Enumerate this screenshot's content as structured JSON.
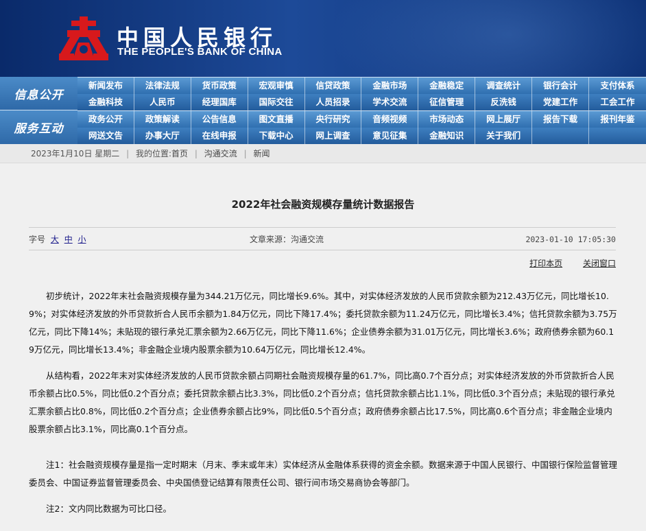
{
  "header": {
    "name_cn": "中国人民银行",
    "name_en": "THE PEOPLE'S BANK OF CHINA",
    "brand_color": "#d7191c"
  },
  "nav": {
    "groups": [
      {
        "tag": "信息公开",
        "rows": [
          [
            "新闻发布",
            "法律法规",
            "货币政策",
            "宏观审慎",
            "信贷政策",
            "金融市场",
            "金融稳定",
            "调查统计",
            "银行会计",
            "支付体系"
          ],
          [
            "金融科技",
            "人民币",
            "经理国库",
            "国际交往",
            "人员招录",
            "学术交流",
            "征信管理",
            "反洗钱",
            "党建工作",
            "工会工作"
          ]
        ]
      },
      {
        "tag": "服务互动",
        "rows": [
          [
            "政务公开",
            "政策解读",
            "公告信息",
            "图文直播",
            "央行研究",
            "音频视频",
            "市场动态",
            "网上展厅",
            "报告下载",
            "报刊年鉴"
          ],
          [
            "网送文告",
            "办事大厅",
            "在线申报",
            "下载中心",
            "网上调查",
            "意见征集",
            "金融知识",
            "关于我们",
            "",
            ""
          ]
        ]
      }
    ]
  },
  "breadcrumb": {
    "date": "2023年1月10日 星期二",
    "location_label": "我的位置:",
    "home": "首页",
    "section": "沟通交流",
    "page": "新闻"
  },
  "article": {
    "title": "2022年社会融资规模存量统计数据报告",
    "font_label": "字号",
    "font_large": "大",
    "font_medium": "中",
    "font_small": "小",
    "source": "文章来源：沟通交流",
    "datetime": "2023-01-10 17:05:30",
    "print_label": "打印本页",
    "close_label": "关闭窗口",
    "paragraphs": [
      "初步统计，2022年末社会融资规模存量为344.21万亿元，同比增长9.6%。其中，对实体经济发放的人民币贷款余额为212.43万亿元，同比增长10.9%；对实体经济发放的外币贷款折合人民币余额为1.84万亿元，同比下降17.4%；委托贷款余额为11.24万亿元，同比增长3.4%；信托贷款余额为3.75万亿元，同比下降14%；未贴现的银行承兑汇票余额为2.66万亿元，同比下降11.6%；企业债券余额为31.01万亿元，同比增长3.6%；政府债券余额为60.19万亿元，同比增长13.4%；非金融企业境内股票余额为10.64万亿元，同比增长12.4%。",
      "从结构看，2022年末对实体经济发放的人民币贷款余额占同期社会融资规模存量的61.7%，同比高0.7个百分点；对实体经济发放的外币贷款折合人民币余额占比0.5%，同比低0.2个百分点；委托贷款余额占比3.3%，同比低0.2个百分点；信托贷款余额占比1.1%，同比低0.3个百分点；未贴现的银行承兑汇票余额占比0.8%，同比低0.2个百分点；企业债券余额占比9%，同比低0.5个百分点；政府债券余额占比17.5%，同比高0.6个百分点；非金融企业境内股票余额占比3.1%，同比高0.1个百分点。",
      "注1：社会融资规模存量是指一定时期末（月末、季末或年末）实体经济从金融体系获得的资金余额。数据来源于中国人民银行、中国银行保险监督管理委员会、中国证券监督管理委员会、中央国债登记结算有限责任公司、银行间市场交易商协会等部门。",
      "注2：文内同比数据为可比口径。"
    ]
  }
}
